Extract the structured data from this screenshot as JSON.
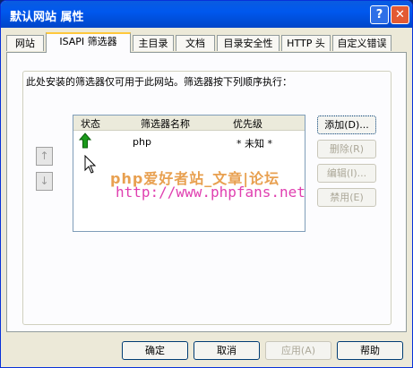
{
  "window": {
    "title": "默认网站 属性",
    "help_glyph": "?",
    "close_glyph": "✕"
  },
  "tabs": [
    {
      "label": "网站"
    },
    {
      "label": "ISAPI 筛选器"
    },
    {
      "label": "主目录"
    },
    {
      "label": "文档"
    },
    {
      "label": "目录安全性"
    },
    {
      "label": "HTTP 头"
    },
    {
      "label": "自定义错误"
    }
  ],
  "description": "此处安装的筛选器仅可用于此网站。筛选器按下列顺序执行：",
  "list": {
    "headers": [
      "状态",
      "筛选器名称",
      "优先级"
    ],
    "rows": [
      {
        "status_icon": "green-up-arrow",
        "name": "php",
        "priority": "* 未知 *"
      }
    ]
  },
  "order_buttons": {
    "up": "↑",
    "down": "↓"
  },
  "side_buttons": [
    "添加(D)...",
    "删除(R)",
    "编辑(I)...",
    "禁用(E)"
  ],
  "watermark": {
    "line1": "php爱好者站_文章|论坛",
    "line2": "http://www.phpfans.net"
  },
  "footer_buttons": [
    "确定",
    "取消",
    "应用(A)",
    "帮助"
  ],
  "colors": {
    "titlebar": "#0058ee",
    "active_tab_accent": "#ffc83c",
    "status_arrow": "#1a9a1a"
  }
}
